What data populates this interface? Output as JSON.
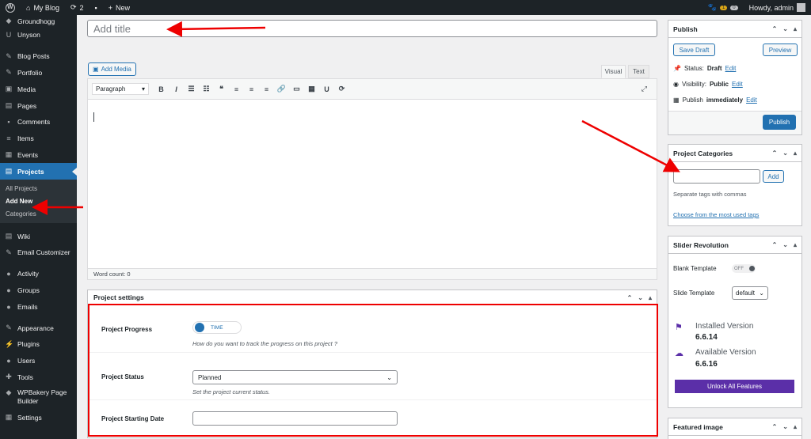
{
  "admin_bar": {
    "site_name": "My Blog",
    "updates_count": "2",
    "comments_count": "0",
    "new_label": "New",
    "plugin_badge": "1",
    "notif_count": "0",
    "greeting": "Howdy, admin"
  },
  "sidebar": {
    "items_top": [
      {
        "label": "Groundhogg",
        "icon": "groundhog-icon"
      },
      {
        "label": "Unyson",
        "icon": "unyson-icon"
      }
    ],
    "items_mid": [
      {
        "label": "Blog Posts",
        "icon": "pin-icon"
      },
      {
        "label": "Portfolio",
        "icon": "pin-icon"
      },
      {
        "label": "Media",
        "icon": "media-icon"
      },
      {
        "label": "Pages",
        "icon": "pages-icon"
      },
      {
        "label": "Comments",
        "icon": "comments-icon"
      },
      {
        "label": "Items",
        "icon": "list-icon"
      },
      {
        "label": "Events",
        "icon": "calendar-icon"
      },
      {
        "label": "Projects",
        "icon": "projects-icon"
      }
    ],
    "submenu": [
      "All Projects",
      "Add New",
      "Categories"
    ],
    "items_bottom": [
      {
        "label": "Wiki",
        "icon": "wiki-icon"
      },
      {
        "label": "Email Customizer",
        "icon": "brush-icon"
      },
      {
        "label": "Activity",
        "icon": "activity-icon"
      },
      {
        "label": "Groups",
        "icon": "groups-icon"
      },
      {
        "label": "Emails",
        "icon": "email-icon"
      },
      {
        "label": "Appearance",
        "icon": "appearance-icon"
      },
      {
        "label": "Plugins",
        "icon": "plugins-icon"
      },
      {
        "label": "Users",
        "icon": "users-icon"
      },
      {
        "label": "Tools",
        "icon": "tools-icon"
      },
      {
        "label": "WPBakery Page Builder",
        "icon": "wpbakery-icon"
      },
      {
        "label": "Settings",
        "icon": "settings-icon"
      }
    ]
  },
  "editor": {
    "title_placeholder": "Add title",
    "add_media": "Add Media",
    "tab_visual": "Visual",
    "tab_text": "Text",
    "format": "Paragraph",
    "word_count": "Word count: 0"
  },
  "project_settings": {
    "title": "Project settings",
    "progress_label": "Project Progress",
    "progress_toggle": "TIME",
    "progress_help": "How do you want to track the progress on this project ?",
    "status_label": "Project Status",
    "status_value": "Planned",
    "status_help": "Set the project current status.",
    "start_label": "Project Starting Date"
  },
  "publish": {
    "title": "Publish",
    "save_draft": "Save Draft",
    "preview": "Preview",
    "status_label": "Status:",
    "status_value": "Draft",
    "visibility_label": "Visibility:",
    "visibility_value": "Public",
    "publish_label": "Publish",
    "publish_value": "immediately",
    "edit": "Edit",
    "publish_button": "Publish"
  },
  "categories": {
    "title": "Project Categories",
    "add": "Add",
    "help": "Separate tags with commas",
    "choose": "Choose from the most used tags"
  },
  "slider": {
    "title": "Slider Revolution",
    "blank_label": "Blank Template",
    "blank_toggle": "OFF",
    "slide_label": "Slide Template",
    "slide_value": "default",
    "installed_title": "Installed Version",
    "installed_value": "6.6.14",
    "available_title": "Available Version",
    "available_value": "6.6.16",
    "unlock": "Unlock All Features"
  },
  "featured": {
    "title": "Featured image"
  },
  "colors": {
    "accent": "#2271b1",
    "annotation": "#e00000",
    "purple": "#5b2fa8"
  }
}
